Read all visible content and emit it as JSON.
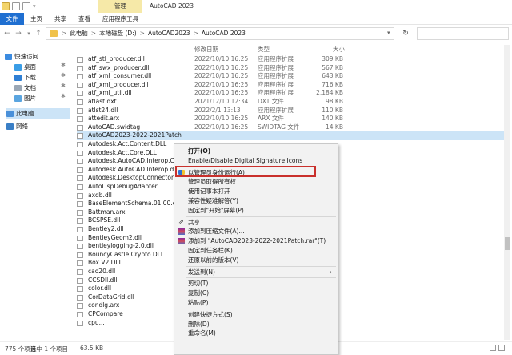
{
  "window": {
    "manage_tab": "管理",
    "title": "AutoCAD 2023"
  },
  "ribbon": {
    "file": "文件",
    "tabs": [
      "主页",
      "共享",
      "查看",
      "应用程序工具"
    ]
  },
  "address": {
    "crumbs": [
      "此电脑",
      "本地磁盘 (D:)",
      "AutoCAD2023",
      "AutoCAD 2023"
    ],
    "separator": ">"
  },
  "sidebar": {
    "quick_access": "快速访问",
    "items": [
      "桌面",
      "下载",
      "文档",
      "图片"
    ],
    "this_pc": "此电脑",
    "network": "网络"
  },
  "columns": {
    "date": "修改日期",
    "type": "类型",
    "size": "大小"
  },
  "files": [
    {
      "name": "atf_stl_producer.dll",
      "date": "2022/10/10 16:25",
      "type": "应用程序扩展",
      "size": "309 KB"
    },
    {
      "name": "atf_swx_producer.dll",
      "date": "2022/10/10 16:25",
      "type": "应用程序扩展",
      "size": "567 KB"
    },
    {
      "name": "atf_xml_consumer.dll",
      "date": "2022/10/10 16:25",
      "type": "应用程序扩展",
      "size": "643 KB"
    },
    {
      "name": "atf_xml_producer.dll",
      "date": "2022/10/10 16:25",
      "type": "应用程序扩展",
      "size": "716 KB"
    },
    {
      "name": "atf_xml_util.dll",
      "date": "2022/10/10 16:25",
      "type": "应用程序扩展",
      "size": "2,184 KB"
    },
    {
      "name": "atlast.dxt",
      "date": "2021/12/10 12:34",
      "type": "DXT 文件",
      "size": "98 KB"
    },
    {
      "name": "atlst24.dll",
      "date": "2022/2/1 13:13",
      "type": "应用程序扩展",
      "size": "110 KB"
    },
    {
      "name": "attedit.arx",
      "date": "2022/10/10 16:25",
      "type": "ARX 文件",
      "size": "140 KB"
    },
    {
      "name": "AutoCAD.swidtag",
      "date": "2022/10/10 16:25",
      "type": "SWIDTAG 文件",
      "size": "14 KB"
    },
    {
      "name": "AutoCAD2023-2022-2021Patch",
      "date": "",
      "type": "",
      "size": ""
    },
    {
      "name": "Autodesk.Act.Content.DLL",
      "date": "",
      "type": "",
      "size": ""
    },
    {
      "name": "Autodesk.Act.Core.DLL",
      "date": "",
      "type": "",
      "size": ""
    },
    {
      "name": "Autodesk.AutoCAD.Interop.Comm",
      "date": "",
      "type": "",
      "size": ""
    },
    {
      "name": "Autodesk.AutoCAD.Interop.dll",
      "date": "",
      "type": "",
      "size": ""
    },
    {
      "name": "Autodesk.DesktopConnector.API",
      "date": "",
      "type": "",
      "size": ""
    },
    {
      "name": "AutoLispDebugAdapter",
      "date": "",
      "type": "",
      "size": ""
    },
    {
      "name": "axdb.dll",
      "date": "",
      "type": "",
      "size": ""
    },
    {
      "name": "BaseElementSchema.01.00.ecsche",
      "date": "",
      "type": "",
      "size": ""
    },
    {
      "name": "Battman.arx",
      "date": "",
      "type": "",
      "size": ""
    },
    {
      "name": "BCSPSE.dll",
      "date": "",
      "type": "",
      "size": ""
    },
    {
      "name": "Bentley2.dll",
      "date": "",
      "type": "",
      "size": ""
    },
    {
      "name": "BentleyGeom2.dll",
      "date": "",
      "type": "",
      "size": ""
    },
    {
      "name": "bentleylogging-2.0.dll",
      "date": "",
      "type": "",
      "size": ""
    },
    {
      "name": "BouncyCastle.Crypto.DLL",
      "date": "",
      "type": "",
      "size": ""
    },
    {
      "name": "Box.V2.DLL",
      "date": "",
      "type": "",
      "size": ""
    },
    {
      "name": "cao20.dll",
      "date": "",
      "type": "",
      "size": ""
    },
    {
      "name": "CCSDll.dll",
      "date": "",
      "type": "",
      "size": ""
    },
    {
      "name": "color.dll",
      "date": "",
      "type": "",
      "size": ""
    },
    {
      "name": "CorDataGrid.dll",
      "date": "",
      "type": "",
      "size": ""
    },
    {
      "name": "condlg.arx",
      "date": "",
      "type": "",
      "size": ""
    },
    {
      "name": "CPCompare",
      "date": "",
      "type": "",
      "size": ""
    },
    {
      "name": "cpu...",
      "date": "",
      "type": "",
      "size": ""
    }
  ],
  "context_menu": {
    "items": [
      {
        "label": "打开(O)",
        "icon": ""
      },
      {
        "label": "Enable/Disable Digital Signature Icons",
        "icon": ""
      },
      {
        "label": "以管理员身份运行(A)",
        "icon": "shield-icon"
      },
      {
        "label": "管理员取得所有权",
        "icon": ""
      },
      {
        "label": "使用记事本打开",
        "icon": ""
      },
      {
        "label": "兼容性疑难解答(Y)",
        "icon": ""
      },
      {
        "label": "固定到\"开始\"屏幕(P)",
        "icon": ""
      },
      {
        "label": "共享",
        "icon": "share-icon"
      },
      {
        "label": "添加到压缩文件(A)...",
        "icon": "archive-icon"
      },
      {
        "label": "添加到 \"AutoCAD2023-2022-2021Patch.rar\"(T)",
        "icon": "archive-icon"
      },
      {
        "label": "固定到任务栏(K)",
        "icon": ""
      },
      {
        "label": "还原以前的版本(V)",
        "icon": ""
      },
      {
        "label": "发送到(N)",
        "icon": "",
        "submenu": true
      },
      {
        "label": "剪切(T)",
        "icon": ""
      },
      {
        "label": "复制(C)",
        "icon": ""
      },
      {
        "label": "粘贴(P)",
        "icon": ""
      },
      {
        "label": "创建快捷方式(S)",
        "icon": ""
      },
      {
        "label": "删除(D)",
        "icon": ""
      },
      {
        "label": "重命名(M)",
        "icon": ""
      }
    ]
  },
  "status": {
    "count": "775 个项目",
    "selected": "选中 1 个项目",
    "size": "63.5 KB"
  },
  "colors": {
    "accent": "#1f6fd1",
    "selection": "#cce4f7",
    "highlight_border": "#c9302c",
    "manage_tab": "#f6e9a8"
  }
}
